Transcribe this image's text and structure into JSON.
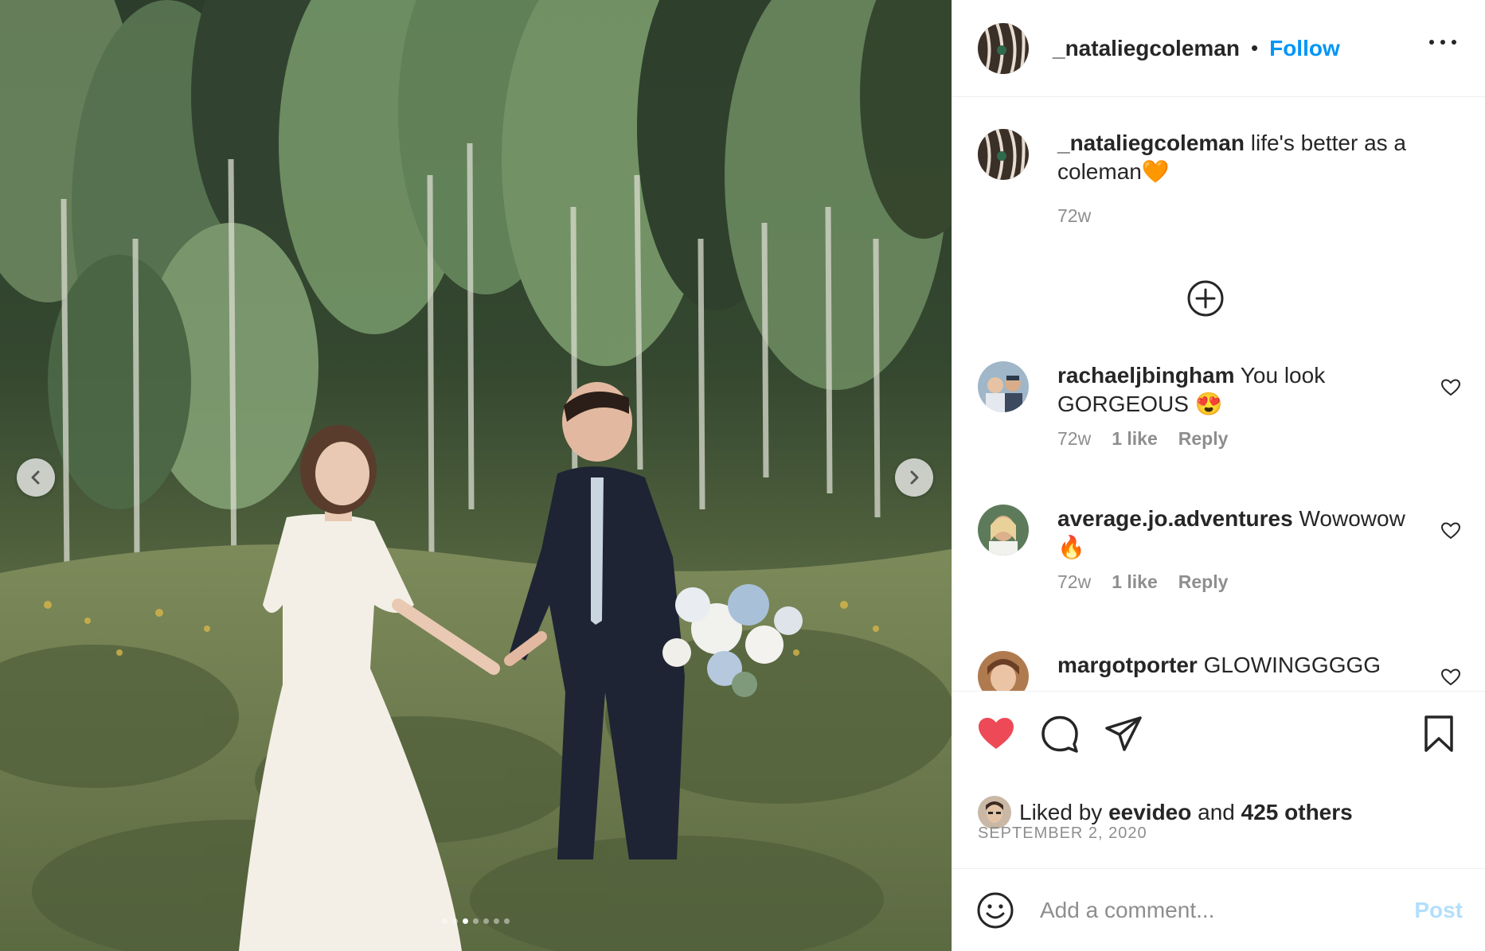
{
  "post": {
    "author": "_nataliegcoleman",
    "separator": "•",
    "follow_label": "Follow",
    "caption_username": "_nataliegcoleman",
    "caption_text": "life's better as a coleman🧡",
    "caption_age": "72w",
    "photo_description": "bride and groom holding hands in an aspen meadow",
    "carousel": {
      "total_slides": 7,
      "active_slide": 2
    },
    "comments": [
      {
        "username": "rachaeljbingham",
        "text": "You look GORGEOUS 😍",
        "age": "72w",
        "likes": "1 like",
        "reply": "Reply"
      },
      {
        "username": "average.jo.adventures",
        "text": "Wowowow 🔥",
        "age": "72w",
        "likes": "1 like",
        "reply": "Reply"
      },
      {
        "username": "margotporter",
        "text": "GLOWINGGGGG",
        "age": "",
        "likes": "",
        "reply": ""
      }
    ],
    "liked_by_prefix": "Liked by",
    "liked_by_user": "eevideo",
    "liked_by_and": "and",
    "liked_by_others": "425 others",
    "date": "SEPTEMBER 2, 2020",
    "comment_placeholder": "Add a comment...",
    "post_label": "Post"
  },
  "colors": {
    "accent": "#0095f6",
    "heart": "#ed4956",
    "muted": "#8e8e8e",
    "post_disabled": "#b2dffc"
  },
  "icons": [
    "more-icon",
    "add-circle-icon",
    "heart-icon",
    "comment-icon",
    "share-icon",
    "bookmark-icon",
    "emoji-icon",
    "chevron-left-icon",
    "chevron-right-icon"
  ]
}
